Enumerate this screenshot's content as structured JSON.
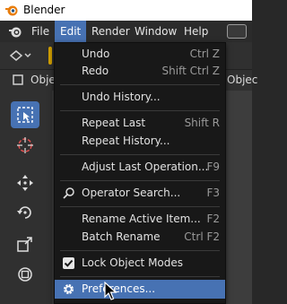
{
  "window": {
    "title": "Blender"
  },
  "menubar": {
    "items": [
      {
        "label": "File"
      },
      {
        "label": "Edit"
      },
      {
        "label": "Render"
      },
      {
        "label": "Window"
      },
      {
        "label": "Help"
      }
    ],
    "active": "Edit"
  },
  "header": {
    "left_label": "Objec",
    "right_label": "Objec"
  },
  "edit_menu": {
    "items": [
      {
        "label": "Undo",
        "shortcut": "Ctrl Z"
      },
      {
        "label": "Redo",
        "shortcut": "Shift Ctrl Z"
      },
      {
        "label": "Undo History...",
        "shortcut": ""
      },
      {
        "label": "Repeat Last",
        "shortcut": "Shift R"
      },
      {
        "label": "Repeat History...",
        "shortcut": ""
      },
      {
        "label": "Adjust Last Operation...",
        "shortcut": "F9"
      },
      {
        "label": "Operator Search...",
        "shortcut": "F3",
        "icon": "search-icon"
      },
      {
        "label": "Rename Active Item...",
        "shortcut": "F2"
      },
      {
        "label": "Batch Rename",
        "shortcut": "Ctrl F2"
      },
      {
        "label": "Lock Object Modes",
        "shortcut": "",
        "checked": true
      },
      {
        "label": "Preferences...",
        "shortcut": "",
        "icon": "gear-icon",
        "highlighted": true
      }
    ]
  },
  "colors": {
    "accent": "#4772b3",
    "menu_bg": "#181818",
    "bar_bg": "#2b2b2b"
  }
}
